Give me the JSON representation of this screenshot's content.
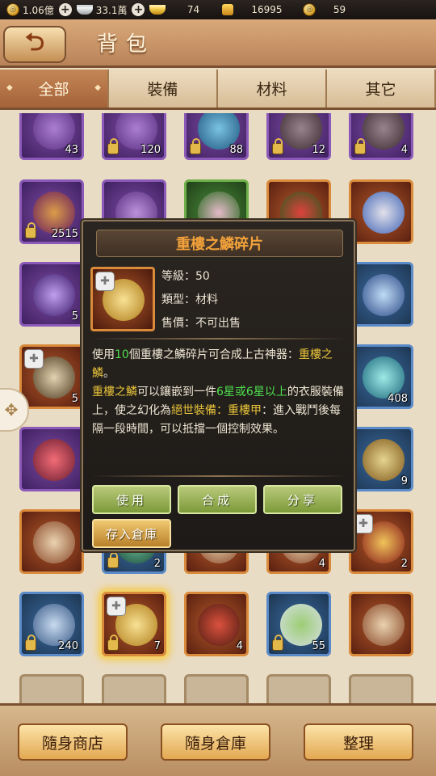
{
  "resources": [
    {
      "icon": "coin-icon",
      "value": "1.06億"
    },
    {
      "icon": "silver-ingot-icon",
      "value": "33.1萬"
    },
    {
      "icon": "gold-ingot-icon",
      "value": "74"
    },
    {
      "icon": "gold-bag-icon",
      "value": "16995"
    },
    {
      "icon": "coin-medal-icon",
      "value": "59"
    }
  ],
  "header": {
    "title": "背包"
  },
  "tabs": [
    "全部",
    "裝備",
    "材料",
    "其它"
  ],
  "grid_counts": {
    "r0": [
      "43",
      "120",
      "88",
      "12",
      "4"
    ],
    "r1c0": "2515",
    "r2c0": "5",
    "r3c0": "5",
    "r3c4": "408",
    "r4c4": "9",
    "r5c1": "2",
    "r5c3": "4",
    "r5c4": "2",
    "r6": [
      "240",
      "7",
      "4",
      "55",
      ""
    ]
  },
  "popup": {
    "title": "重樓之鱗碎片",
    "level_label": "等級：",
    "level": "50",
    "type_label": "類型：",
    "type": "材料",
    "price_label": "售價：",
    "price": "不可出售",
    "desc": {
      "p1": "使用",
      "n1": "10",
      "p2": "個重樓之鱗碎片可合成上古神器：",
      "item": "重樓之鱗",
      "p3": "。",
      "l2a": "重樓之鱗",
      "l2b": "可以鑲嵌到一件",
      "l2c": "6星或6星以上",
      "l2d": "的衣服裝備上，使之幻化為",
      "l2e": "絕世裝備：重樓甲",
      "l2f": "：進入戰鬥後每隔一段時間，可以抵擋一個控制效果。"
    },
    "buttons": {
      "use": "使用",
      "combine": "合成",
      "share": "分享",
      "store": "存入倉庫"
    }
  },
  "bottom": {
    "shop": "隨身商店",
    "warehouse": "隨身倉庫",
    "sort": "整理"
  },
  "colors": {
    "accent": "#f2a23a",
    "highlight": "#4ee04e",
    "gold_text": "#e8c33a"
  }
}
